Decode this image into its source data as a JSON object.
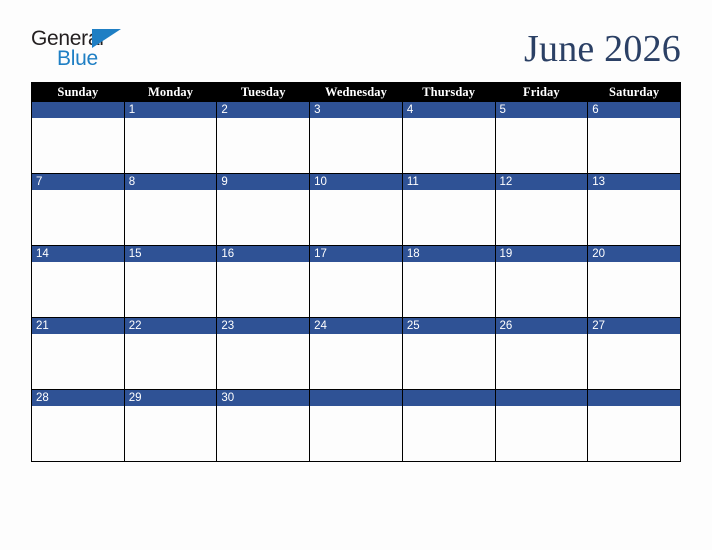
{
  "brand": {
    "name_part1": "General",
    "name_part2": "Blue",
    "triangle_color": "#1f7fc4",
    "text_color": "#231f20"
  },
  "header": {
    "title": "June 2026",
    "title_color": "#2b4065"
  },
  "calendar": {
    "month": "June",
    "year": "2026",
    "header_bg": "#000000",
    "header_text_color": "#ffffff",
    "daynum_bg": "#2f5295",
    "daynum_text_color": "#ffffff",
    "cell_bg": "#fdfdfd",
    "border_color": "#000000",
    "weekday_headers": [
      "Sunday",
      "Monday",
      "Tuesday",
      "Wednesday",
      "Thursday",
      "Friday",
      "Saturday"
    ],
    "weeks": [
      [
        "",
        "1",
        "2",
        "3",
        "4",
        "5",
        "6"
      ],
      [
        "7",
        "8",
        "9",
        "10",
        "11",
        "12",
        "13"
      ],
      [
        "14",
        "15",
        "16",
        "17",
        "18",
        "19",
        "20"
      ],
      [
        "21",
        "22",
        "23",
        "24",
        "25",
        "26",
        "27"
      ],
      [
        "28",
        "29",
        "30",
        "",
        "",
        "",
        ""
      ]
    ]
  }
}
